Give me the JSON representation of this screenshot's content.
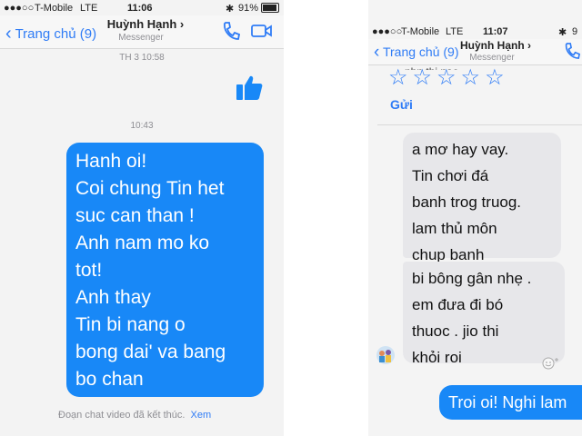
{
  "left": {
    "status": {
      "carrier": "T-Mobile",
      "network": "LTE",
      "time": "11:06",
      "battery": "91%"
    },
    "nav": {
      "back_label": "Trang chủ (9)",
      "contact_name": "Huỳnh Hạnh",
      "contact_sub": "Messenger"
    },
    "timestamps": {
      "first": "TH 3 10:58",
      "second": "10:43"
    },
    "message_lines": [
      "Hanh oi!",
      "Coi chung Tin het",
      "suc can than !",
      "Anh nam mo ko",
      "tot!",
      "Anh thay",
      "Tin bi nang o",
      "bong dai' va bang",
      "bo chan"
    ],
    "footer": {
      "text": "Đoạn chat video đã kết thúc.",
      "link": "Xem"
    }
  },
  "right": {
    "status": {
      "carrier": "T-Mobile",
      "network": "LTE",
      "time": "11:07",
      "battery": "9"
    },
    "nav": {
      "back_label": "Trang chủ (9)",
      "contact_name": "Huỳnh Hạnh",
      "contact_sub": "Messenger"
    },
    "partial_text": "nhn thi nao.",
    "stars": "☆☆☆☆☆",
    "send_label": "Gửi",
    "received1_lines": [
      "a mơ hay vay.",
      "Tin chơi đá",
      "banh trog truog.",
      "lam thủ môn",
      "chup banh"
    ],
    "received2_lines": [
      "bi bông gân nhẹ .",
      "em đưa đi bó",
      "thuoc . jio thi",
      "khỏi roi"
    ],
    "sent_text": "Troi oi! Nghi lam"
  },
  "colors": {
    "accent": "#2f7cf6",
    "sent_bubble": "#1888f7",
    "received_bubble": "#e7e7ea"
  }
}
